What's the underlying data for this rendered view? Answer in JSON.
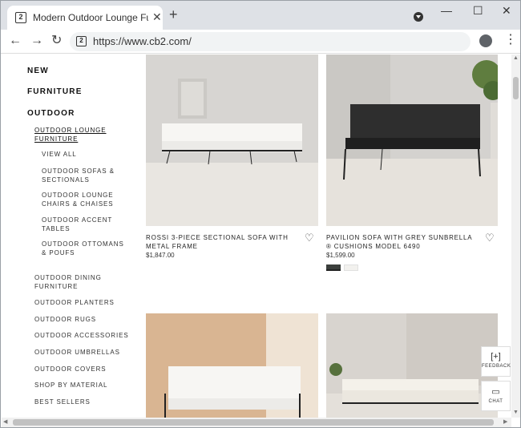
{
  "browser": {
    "tab_title": "Modern Outdoor Lounge Furniture",
    "favicon_text": "2",
    "url": "https://www.cb2.com/",
    "new_tab_label": "+",
    "tab_close_label": "✕",
    "minimize_label": "—",
    "maximize_label": "☐",
    "close_label": "✕"
  },
  "sidebar": {
    "top": [
      "NEW",
      "FURNITURE",
      "OUTDOOR"
    ],
    "active": "OUTDOOR LOUNGE FURNITURE",
    "sub": [
      "VIEW ALL",
      "OUTDOOR SOFAS & SECTIONALS",
      "OUTDOOR LOUNGE CHAIRS & CHAISES",
      "OUTDOOR ACCENT TABLES",
      "OUTDOOR OTTOMANS & POUFS"
    ],
    "more": [
      "OUTDOOR DINING FURNITURE",
      "OUTDOOR PLANTERS",
      "OUTDOOR RUGS",
      "OUTDOOR ACCESSORIES",
      "OUTDOOR UMBRELLAS",
      "OUTDOOR COVERS",
      "SHOP BY MATERIAL",
      "BEST SELLERS"
    ]
  },
  "products": [
    {
      "name": "ROSSI 3-PIECE SECTIONAL SOFA WITH METAL FRAME",
      "price": "$1,847.00"
    },
    {
      "name": "PAVILION SOFA WITH GREY SUNBRELLA ® CUSHIONS MODEL 6490",
      "price": "$1,599.00",
      "swatches": [
        "#3b3f3c",
        "#f2f1ee"
      ]
    }
  ],
  "floating": {
    "feedback": "FEEDBACK",
    "chat": "CHAT"
  }
}
